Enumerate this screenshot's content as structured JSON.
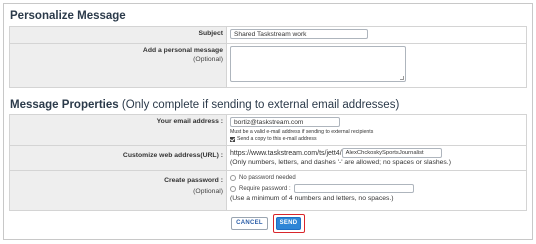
{
  "personalize": {
    "title": "Personalize Message",
    "subject_label": "Subject",
    "subject_value": "Shared Taskstream work",
    "message_label": "Add a personal message",
    "message_optional": "(Optional)"
  },
  "properties": {
    "title": "Message Properties",
    "subtitle": "(Only complete if sending to external email addresses)",
    "email_label": "Your email address :",
    "email_value": "bortiz@taskstream.com",
    "email_hint": "Must be a valid e-mail address if sending to external recipients",
    "copy_label": "Send a copy to this e-mail address",
    "copy_checked": true,
    "url_label": "Customize web address(URL) :",
    "url_prefix": "https://www.taskstream.com/ts/jett4/",
    "url_value": "AlexChckoskySportsJournalist",
    "url_note": "(Only numbers, letters, and dashes '-' are allowed; no spaces or slashes.)",
    "password_label": "Create password :",
    "password_optional": "(Optional)",
    "no_password_label": "No password needed",
    "require_password_label": "Require password :",
    "password_note": "(Use a minimum of 4 numbers and letters, no spaces.)"
  },
  "buttons": {
    "cancel": "CANCEL",
    "send": "SEND"
  },
  "colors": {
    "title": "#2b3a4a",
    "send_bg": "#2f86d6",
    "send_highlight": "#d9262c",
    "label_bg": "#eeeeee"
  }
}
